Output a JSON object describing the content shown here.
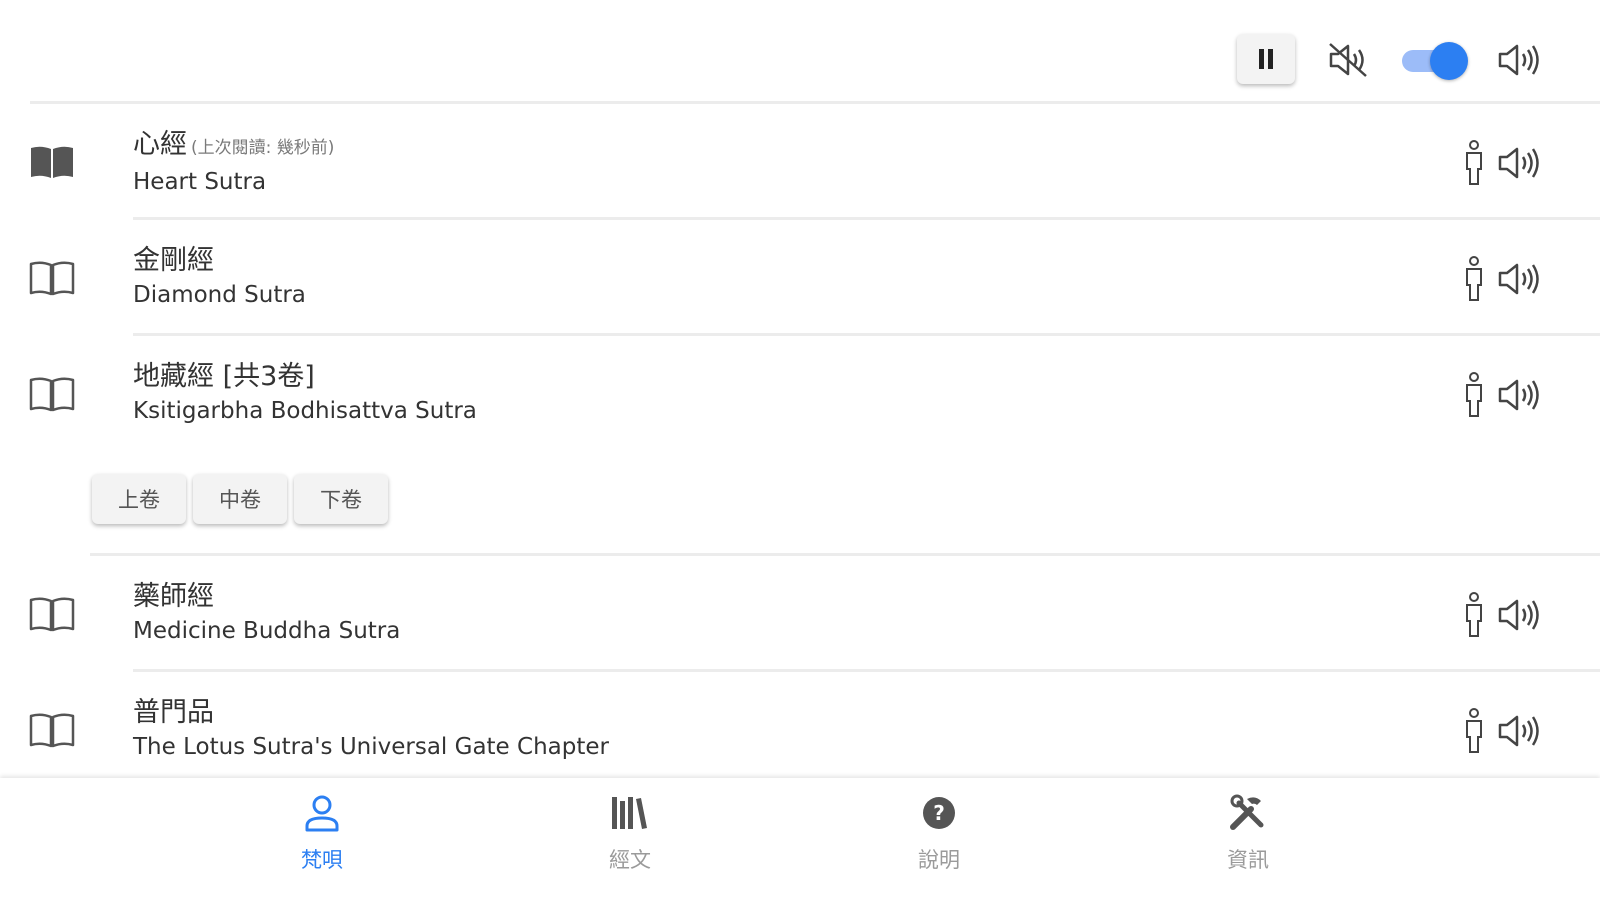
{
  "controls": {
    "pause_icon": "pause-icon",
    "mute_icon": "volume-off-icon",
    "toggle_on": true,
    "volume_icon": "volume-up-icon",
    "accent_color": "#2c7ff2"
  },
  "sutras": [
    {
      "title_zh": "心經",
      "last_read": "(上次閱讀: 幾秒前)",
      "title_en": "Heart Sutra",
      "icon": "book-filled-icon"
    },
    {
      "title_zh": "金剛經",
      "title_en": "Diamond Sutra",
      "icon": "book-outline-icon"
    },
    {
      "title_zh": "地藏經 [共3卷]",
      "title_en": "Ksitigarbha Bodhisattva Sutra",
      "icon": "book-outline-icon",
      "chapters": [
        "上卷",
        "中卷",
        "下卷"
      ]
    },
    {
      "title_zh": "藥師經",
      "title_en": "Medicine Buddha Sutra",
      "icon": "book-outline-icon"
    },
    {
      "title_zh": "普門品",
      "title_en": "The Lotus Sutra's Universal Gate Chapter",
      "icon": "book-outline-icon"
    }
  ],
  "nav": [
    {
      "label": "梵唄",
      "icon": "person-icon",
      "active": true
    },
    {
      "label": "經文",
      "icon": "library-icon",
      "active": false
    },
    {
      "label": "說明",
      "icon": "help-icon",
      "active": false
    },
    {
      "label": "資訊",
      "icon": "tools-icon",
      "active": false
    }
  ]
}
